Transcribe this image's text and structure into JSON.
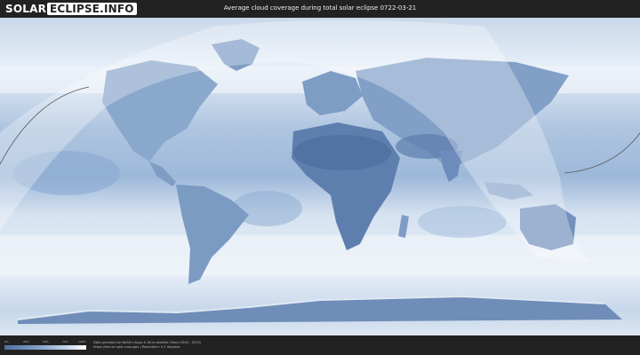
{
  "header": {
    "logo_part1": "SOLAR",
    "logo_part2": "ECLIPSE.INFO",
    "title": "Average cloud coverage during total solar eclipse 0722-03-21"
  },
  "legend": {
    "ticks": [
      "0%",
      "25%",
      "50%",
      "75%",
      "100%"
    ]
  },
  "credits": {
    "line1": "Data provided by NASA's Aqua & Terra satellite (Years 2000 - 2019)",
    "line2": "https://neo.sci.gsfc.nasa.gov | Resolution: 0.1 degrees"
  },
  "colors": {
    "background": "#222222",
    "ocean_cloud": "#b9cde3",
    "land": "#6f8db7",
    "clear_sky": "#4d6fa0",
    "eclipse_path": "#555555"
  }
}
